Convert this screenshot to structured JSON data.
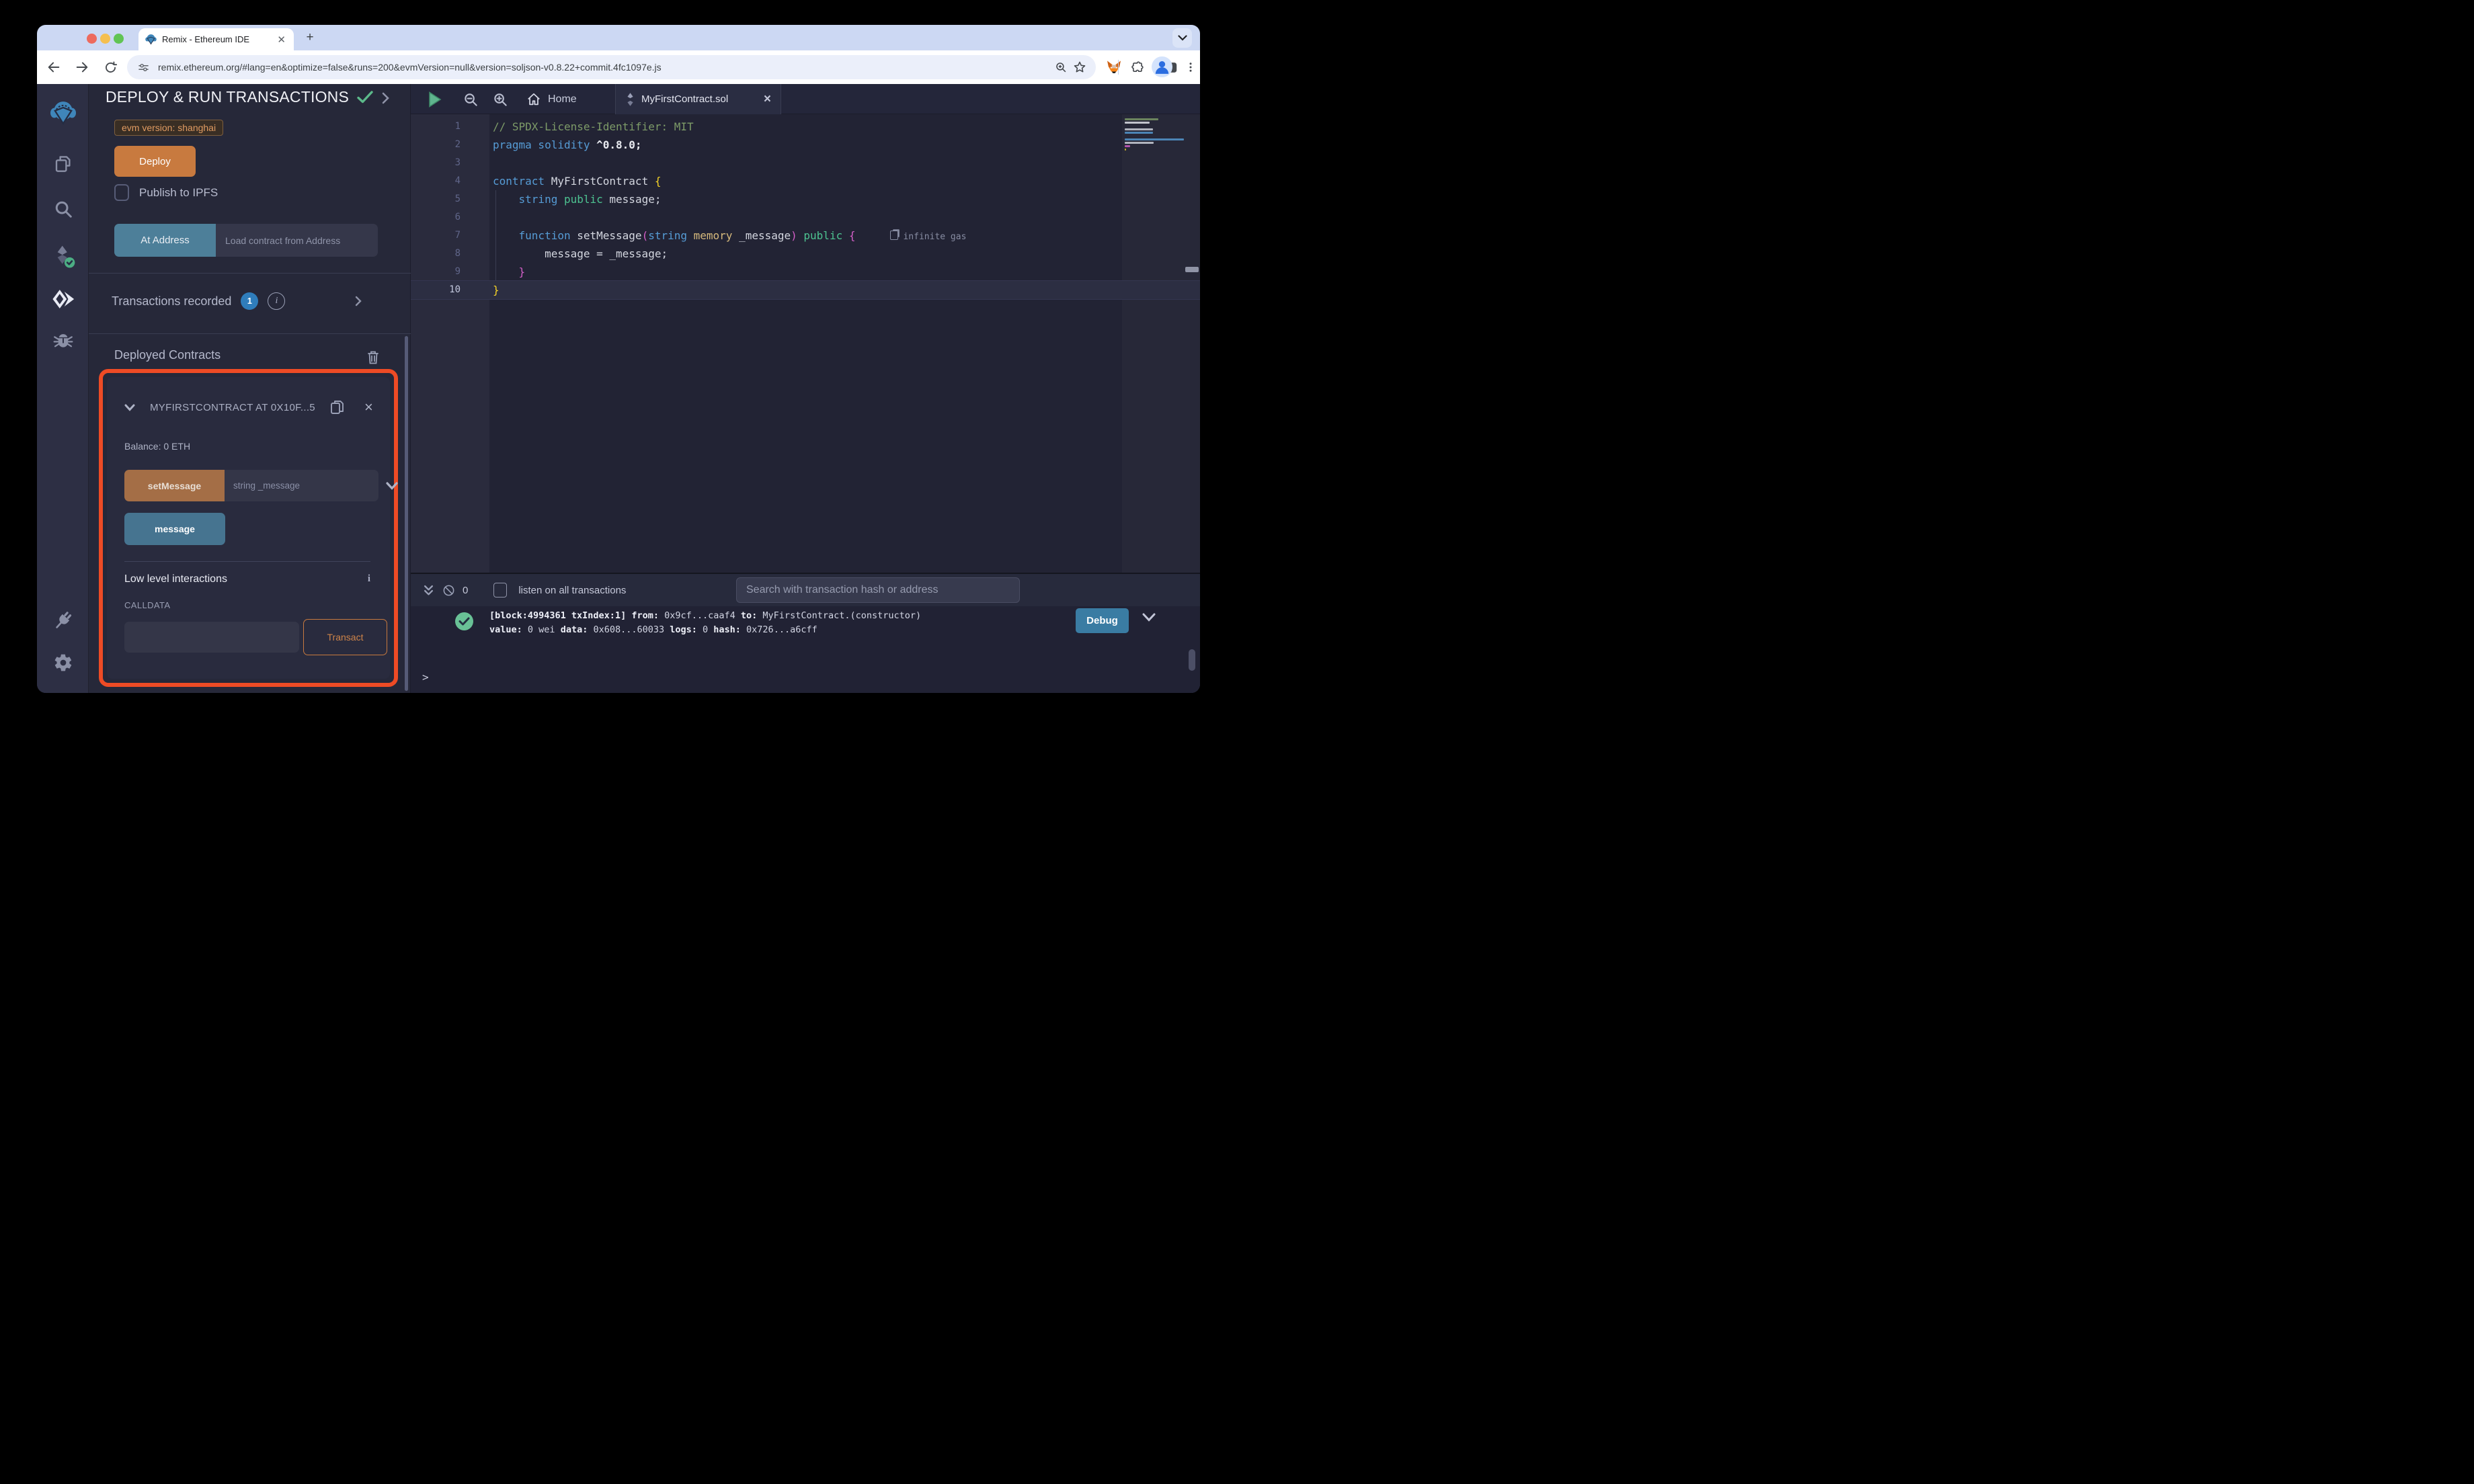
{
  "browser": {
    "tab_title": "Remix - Ethereum IDE",
    "new_tab_label": "+",
    "url": "remix.ethereum.org/#lang=en&optimize=false&runs=200&evmVersion=null&version=soljson-v0.8.22+commit.4fc1097e.js"
  },
  "activity_bar": {
    "icons": [
      "remix-logo",
      "file-explorer",
      "search",
      "solidity-compiler",
      "deploy-and-run",
      "debugger",
      "plugin-manager",
      "settings"
    ]
  },
  "deploy_panel": {
    "title": "DEPLOY & RUN TRANSACTIONS",
    "evm_version_badge": "evm version: shanghai",
    "deploy_button": "Deploy",
    "publish_to_ipfs_label": "Publish to IPFS",
    "at_address_button": "At Address",
    "at_address_placeholder": "Load contract from Address",
    "transactions_recorded": {
      "label": "Transactions recorded",
      "count": "1",
      "info_glyph": "i"
    },
    "deployed_contracts": {
      "header": "Deployed Contracts",
      "contract": {
        "title": "MYFIRSTCONTRACT AT 0X10F...5",
        "balance": "Balance: 0 ETH",
        "close_glyph": "×",
        "set_message_button": "setMessage",
        "set_message_placeholder": "string _message",
        "message_button": "message",
        "low_level": {
          "title": "Low level interactions",
          "info_glyph": "i",
          "calldata_label": "CALLDATA",
          "transact_button": "Transact"
        }
      }
    }
  },
  "editor": {
    "tabs": [
      {
        "label": "Home"
      },
      {
        "label": "MyFirstContract.sol",
        "close_glyph": "×"
      }
    ],
    "code_lines": [
      {
        "n": "1",
        "tokens": [
          [
            "c",
            "// SPDX-License-Identifier: MIT"
          ]
        ]
      },
      {
        "n": "2",
        "tokens": [
          [
            "k",
            "pragma solidity "
          ],
          [
            "b",
            "^0.8.0;"
          ]
        ]
      },
      {
        "n": "3",
        "tokens": []
      },
      {
        "n": "4",
        "tokens": [
          [
            "k",
            "contract "
          ],
          [
            "w",
            "MyFirstContract "
          ],
          [
            "y2",
            "{"
          ]
        ]
      },
      {
        "n": "5",
        "tokens": [
          [
            "w",
            "    "
          ],
          [
            "k",
            "string "
          ],
          [
            "g",
            "public "
          ],
          [
            "w",
            "message;"
          ]
        ]
      },
      {
        "n": "6",
        "tokens": []
      },
      {
        "n": "7",
        "tokens": [
          [
            "w",
            "    "
          ],
          [
            "k",
            "function "
          ],
          [
            "w",
            "setMessage"
          ],
          [
            "p",
            "("
          ],
          [
            "k",
            "string "
          ],
          [
            "y",
            "memory "
          ],
          [
            "w",
            "_message"
          ],
          [
            "p",
            ") "
          ],
          [
            "g",
            "public "
          ],
          [
            "p",
            "{"
          ]
        ],
        "annotation": "infinite gas"
      },
      {
        "n": "8",
        "tokens": [
          [
            "w",
            "        message = _message;"
          ]
        ]
      },
      {
        "n": "9",
        "tokens": [
          [
            "w",
            "    "
          ],
          [
            "p",
            "}"
          ]
        ]
      },
      {
        "n": "10",
        "tokens": [
          [
            "y2",
            "}"
          ]
        ],
        "current": true
      }
    ]
  },
  "terminal": {
    "pending_count": "0",
    "listen_checkbox_label": "listen on all transactions",
    "search_placeholder": "Search with transaction hash or address",
    "log": {
      "line1": [
        [
          "b",
          "[block:4994361 txIndex:1]"
        ],
        [
          "n",
          " "
        ],
        [
          "b",
          "from:"
        ],
        [
          "n",
          " 0x9cf...caaf4 "
        ],
        [
          "b",
          "to:"
        ],
        [
          "n",
          " MyFirstContract.(constructor) "
        ]
      ],
      "line2": [
        [
          "b",
          "value:"
        ],
        [
          "n",
          " 0 wei "
        ],
        [
          "b",
          "data:"
        ],
        [
          "n",
          " 0x608...60033 "
        ],
        [
          "b",
          "logs:"
        ],
        [
          "n",
          " 0 "
        ],
        [
          "b",
          "hash:"
        ],
        [
          "n",
          " 0x726...a6cff"
        ]
      ]
    },
    "debug_button": "Debug",
    "prompt": ">"
  },
  "colors": {
    "accent_orange": "#C87A3F",
    "accent_teal": "#4D7F99",
    "highlight_red": "#EE4B25",
    "badge_blue": "#2F7DBB",
    "debug_blue": "#3A7CA3",
    "success_green": "#69C196"
  }
}
